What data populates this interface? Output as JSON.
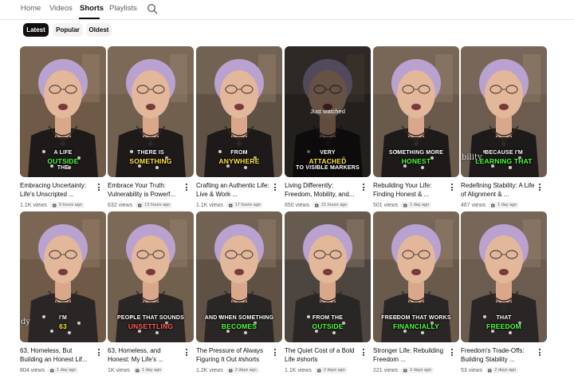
{
  "tabs": [
    {
      "label": "Home"
    },
    {
      "label": "Videos"
    },
    {
      "label": "Shorts"
    },
    {
      "label": "Playlists"
    }
  ],
  "active_tab": "Shorts",
  "chips": [
    {
      "label": "Latest"
    },
    {
      "label": "Popular"
    },
    {
      "label": "Oldest"
    }
  ],
  "active_chip": "Latest",
  "colors": {
    "accent_text": "#ffffff",
    "highlight_green": "#4cff3a",
    "highlight_yellow": "#ffe23c",
    "highlight_red": "#ff5a5a"
  },
  "videos": [
    {
      "title": "Embracing Uncertainty: Life's Unscripted ...",
      "views": "1.1K views",
      "age": "9 hours ago",
      "caption_top": "A LIFE",
      "caption_hl": "OUTSIDE",
      "caption_bottom": "THE",
      "hl_color": "#4cff3a",
      "watched": ""
    },
    {
      "title": "Embrace Your Truth: Vulnerability is Powerf...",
      "views": "632 views",
      "age": "13 hours ago",
      "caption_top": "THERE IS",
      "caption_hl": "SOMETHING",
      "caption_bottom": "",
      "hl_color": "#ffe23c",
      "watched": ""
    },
    {
      "title": "Crafting an Authentic Life: Live & Work ...",
      "views": "1.1K views",
      "age": "17 hours ago",
      "caption_top": "FROM",
      "caption_hl": "ANYWHERE",
      "caption_bottom": "",
      "hl_color": "#ffe23c",
      "watched": ""
    },
    {
      "title": "Living Differently: Freedom, Mobility, and...",
      "views": "650 views",
      "age": "21 hours ago",
      "caption_top": "VERY",
      "caption_hl": "ATTACHED",
      "caption_bottom": "TO VISIBLE MARKERS",
      "hl_color": "#ffe23c",
      "watched": "Just watched"
    },
    {
      "title": "Rebuilding Your Life: Finding Honest & ...",
      "views": "501 views",
      "age": "1 day ago",
      "caption_top": "SOMETHING MORE",
      "caption_hl": "HONEST",
      "caption_bottom": "",
      "hl_color": "#4cff3a",
      "watched": ""
    },
    {
      "title": "Redefining Stability: A Life of Alignment & ...",
      "views": "467 views",
      "age": "1 day ago",
      "caption_top": "BECAUSE I'M",
      "caption_hl": "LEARNING THAT",
      "caption_bottom": "",
      "hl_color": "#4cff3a",
      "watched": "",
      "side": "bility"
    },
    {
      "title": "63, Homeless, But Building an Honest Lif...",
      "views": "804 views",
      "age": "1 day ago",
      "caption_top": "I'M",
      "caption_hl": "63",
      "caption_bottom": "",
      "hl_color": "#ffe23c",
      "watched": "",
      "side": "dy"
    },
    {
      "title": "63, Homeless, and Honest: My Life's ...",
      "views": "1K views",
      "age": "1 day ago",
      "caption_top": "PEOPLE THAT SOUNDS",
      "caption_hl": "UNSETTLING",
      "caption_bottom": "",
      "hl_color": "#ff5a5a",
      "watched": ""
    },
    {
      "title": "The Pressure of Always Figuring It Out #shorts",
      "views": "1.2K views",
      "age": "2 days ago",
      "caption_top": "AND WHEN SOMETHING",
      "caption_hl": "BECOMES",
      "caption_bottom": "",
      "hl_color": "#4cff3a",
      "watched": ""
    },
    {
      "title": "The Quiet Cost of a Bold Life #shorts",
      "views": "1.1K views",
      "age": "2 days ago",
      "caption_top": "FROM THE",
      "caption_hl": "OUTSIDE",
      "caption_bottom": "",
      "hl_color": "#4cff3a",
      "watched": ""
    },
    {
      "title": "Stronger Life: Rebuilding Freedom ...",
      "views": "221 views",
      "age": "2 days ago",
      "caption_top": "FREEDOM THAT WORKS",
      "caption_hl": "FINANCIALLY",
      "caption_bottom": "",
      "hl_color": "#4cff3a",
      "watched": ""
    },
    {
      "title": "Freedom's Trade-Offs: Building Stability ...",
      "views": "53 views",
      "age": "2 days ago",
      "caption_top": "THAT",
      "caption_hl": "FREEDOM",
      "caption_bottom": "",
      "hl_color": "#4cff3a",
      "watched": ""
    }
  ]
}
